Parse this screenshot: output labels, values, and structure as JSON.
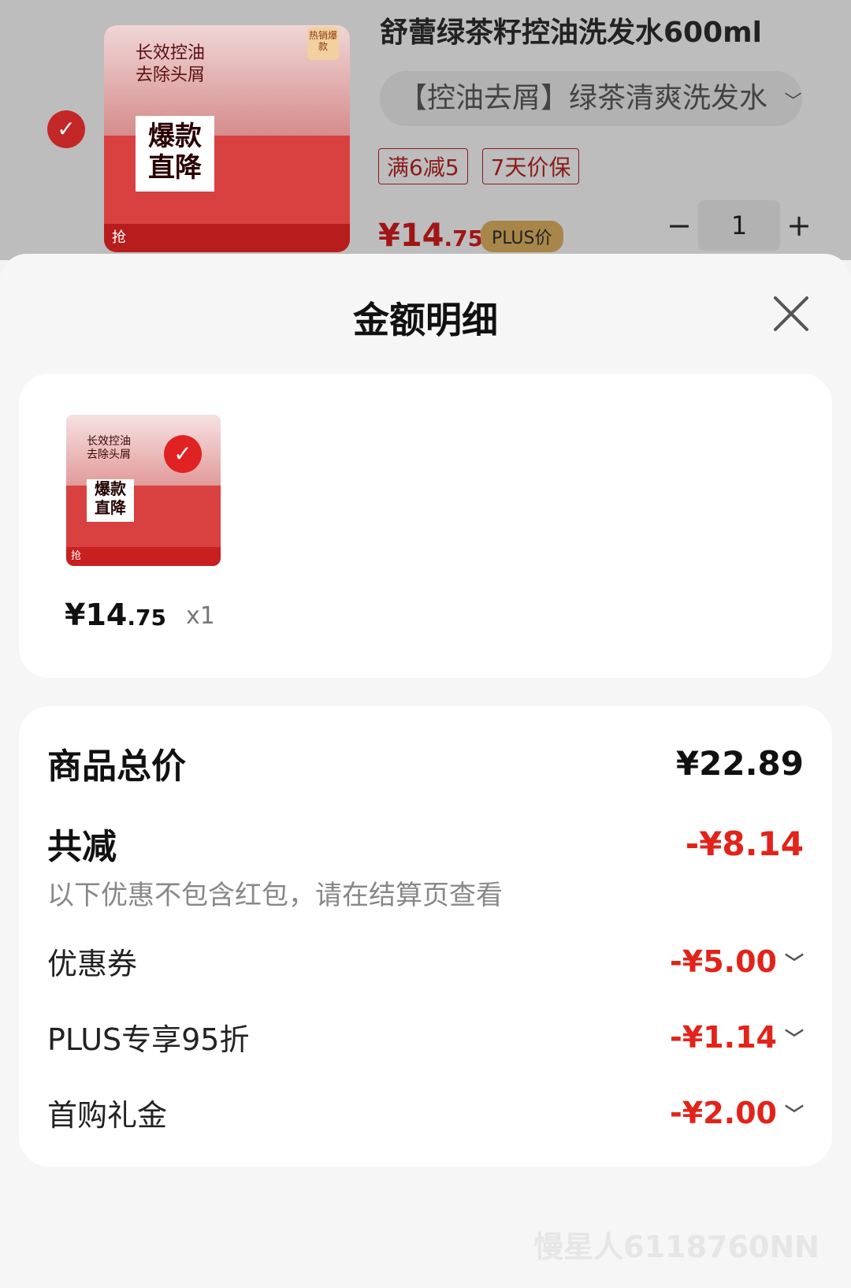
{
  "background_product": {
    "title": "舒蕾绿茶籽控油洗发水600ml",
    "variant": "【控油去屑】绿茶清爽洗发水",
    "variant_chevron_icon": "chevron-down-icon",
    "tags": [
      "满6减5",
      "7天价保"
    ],
    "price_main": "¥14",
    "price_decimal": ".75",
    "plus_badge": "PLUS价",
    "quantity": "1",
    "minus": "−",
    "plus": "+",
    "image_text": {
      "line1": "长效控油",
      "line2": "去除头屑",
      "burst1": "爆款",
      "burst2": "直降",
      "hot": "热销爆款",
      "bottom": "抢"
    }
  },
  "sheet": {
    "title": "金额明细",
    "close_icon": "close-icon",
    "item": {
      "image_text": {
        "line1": "长效控油",
        "line2": "去除头屑",
        "burst1": "爆款",
        "burst2": "直降",
        "bottom": "抢"
      },
      "price_main": "¥14",
      "price_decimal": ".75",
      "quantity": "x1"
    },
    "summary": {
      "total_label": "商品总价",
      "total_value": "¥22.89",
      "reduce_label": "共减",
      "reduce_value": "-¥8.14",
      "note": "以下优惠不包含红包，请在结算页查看",
      "discounts": [
        {
          "label": "优惠券",
          "value": "-¥5.00"
        },
        {
          "label": "PLUS专享95折",
          "value": "-¥1.14"
        },
        {
          "label": "首购礼金",
          "value": "-¥2.00"
        }
      ]
    }
  },
  "watermark": "慢星人6118760NN",
  "colors": {
    "accent_red": "#e2231a"
  }
}
